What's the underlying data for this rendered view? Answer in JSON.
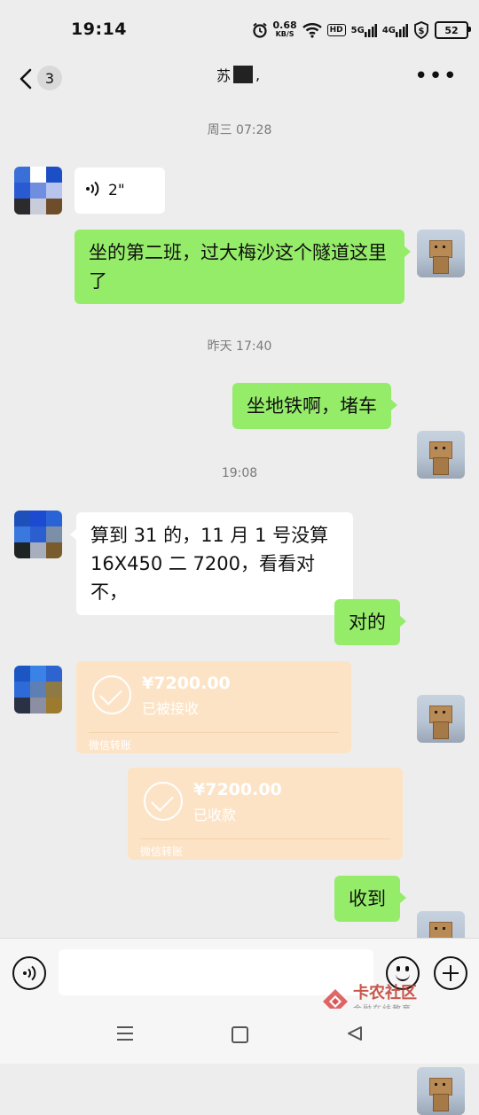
{
  "status": {
    "time": "19:14",
    "net_speed_value": "0.68",
    "net_speed_unit": "KB/S",
    "hd_label": "HD",
    "sig1_label": "5G",
    "sig2_label": "4G",
    "battery": "52"
  },
  "nav": {
    "unread_count": "3",
    "title_prefix": "苏",
    "title_suffix": ","
  },
  "chat": {
    "ts1": "周三 07:28",
    "voice_duration": "2\"",
    "msg1": "坐的第二班，过大梅沙这个隧道这里了",
    "ts2": "昨天 17:40",
    "msg2": "坐地铁啊，堵车",
    "ts3": "19:08",
    "msg3_line1": "算到 31 的，11 月 1 号没算",
    "msg3_line2": "16X450 二 7200，看看对不，",
    "msg4": "对的",
    "transfer_in": {
      "amount": "¥7200.00",
      "status": "已被接收",
      "source": "微信转账"
    },
    "transfer_out": {
      "amount": "¥7200.00",
      "status": "已收款",
      "source": "微信转账"
    },
    "msg5": "收到"
  },
  "input": {
    "placeholder": ""
  },
  "watermark": {
    "name": "卡农社区",
    "slogan": "金融在线教育"
  },
  "colors": {
    "bg": "#ededed",
    "out_bubble": "#95ec69",
    "in_bubble": "#ffffff",
    "transfer": "#fce3c6"
  }
}
